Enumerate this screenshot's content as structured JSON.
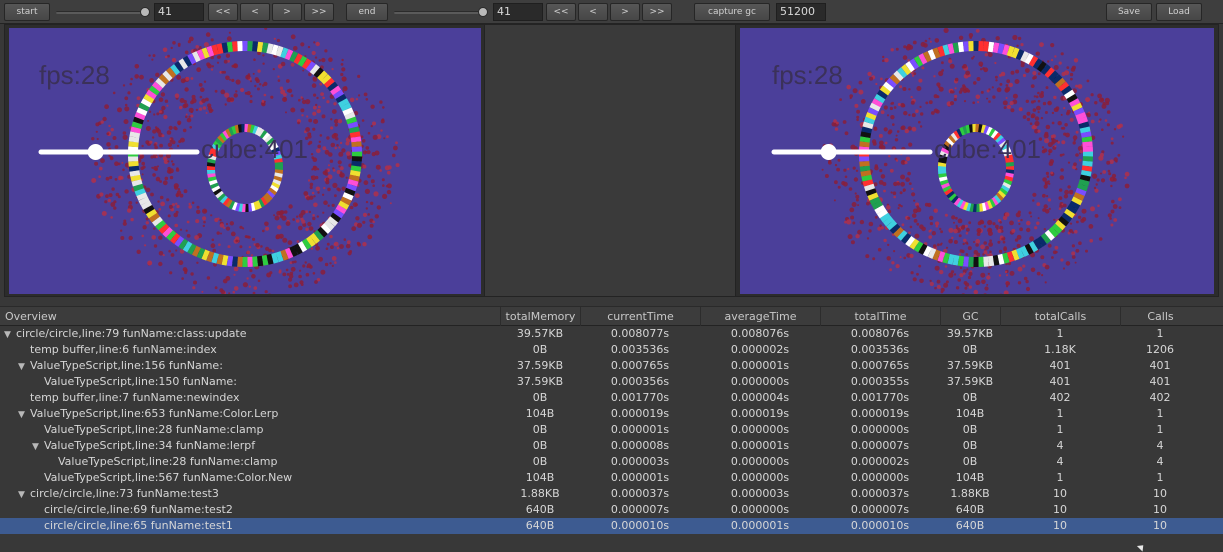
{
  "toolbar": {
    "start_label": "start",
    "start_value": "41",
    "end_label": "end",
    "end_value": "41",
    "nav": [
      "<<",
      "<",
      ">",
      ">>"
    ],
    "capture_gc_label": "capture gc",
    "capture_gc_value": "51200",
    "save_label": "Save",
    "load_label": "Load"
  },
  "preview": {
    "fps_text": "fps:28",
    "cube_text": "cube:401",
    "background": "#4b3f9a",
    "slider_level": 0.35
  },
  "table": {
    "columns": [
      "Overview",
      "totalMemory",
      "currentTime",
      "averageTime",
      "totalTime",
      "GC",
      "totalCalls",
      "Calls"
    ],
    "rows": [
      {
        "expander": "▼",
        "name": "circle/circle,line:79 funName:class:update",
        "totalMemory": "39.57KB",
        "currentTime": "0.008077s",
        "averageTime": "0.008076s",
        "totalTime": "0.008076s",
        "gc": "39.57KB",
        "totalCalls": "1",
        "calls": "1"
      },
      {
        "expander": "",
        "name": "temp buffer,line:6 funName:index",
        "totalMemory": "0B",
        "currentTime": "0.003536s",
        "averageTime": "0.000002s",
        "totalTime": "0.003536s",
        "gc": "0B",
        "totalCalls": "1.18K",
        "calls": "1206"
      },
      {
        "expander": "▼",
        "name": "ValueTypeScript,line:156 funName:",
        "totalMemory": "37.59KB",
        "currentTime": "0.000765s",
        "averageTime": "0.000001s",
        "totalTime": "0.000765s",
        "gc": "37.59KB",
        "totalCalls": "401",
        "calls": "401"
      },
      {
        "expander": "",
        "name": "ValueTypeScript,line:150 funName:",
        "totalMemory": "37.59KB",
        "currentTime": "0.000356s",
        "averageTime": "0.000000s",
        "totalTime": "0.000355s",
        "gc": "37.59KB",
        "totalCalls": "401",
        "calls": "401"
      },
      {
        "expander": "",
        "name": "temp buffer,line:7 funName:newindex",
        "totalMemory": "0B",
        "currentTime": "0.001770s",
        "averageTime": "0.000004s",
        "totalTime": "0.001770s",
        "gc": "0B",
        "totalCalls": "402",
        "calls": "402"
      },
      {
        "expander": "▼",
        "name": "ValueTypeScript,line:653 funName:Color.Lerp",
        "totalMemory": "104B",
        "currentTime": "0.000019s",
        "averageTime": "0.000019s",
        "totalTime": "0.000019s",
        "gc": "104B",
        "totalCalls": "1",
        "calls": "1"
      },
      {
        "expander": "",
        "name": "ValueTypeScript,line:28 funName:clamp",
        "totalMemory": "0B",
        "currentTime": "0.000001s",
        "averageTime": "0.000000s",
        "totalTime": "0.000000s",
        "gc": "0B",
        "totalCalls": "1",
        "calls": "1"
      },
      {
        "expander": "▼",
        "name": "ValueTypeScript,line:34 funName:lerpf",
        "totalMemory": "0B",
        "currentTime": "0.000008s",
        "averageTime": "0.000001s",
        "totalTime": "0.000007s",
        "gc": "0B",
        "totalCalls": "4",
        "calls": "4"
      },
      {
        "expander": "",
        "name": "ValueTypeScript,line:28 funName:clamp",
        "totalMemory": "0B",
        "currentTime": "0.000003s",
        "averageTime": "0.000000s",
        "totalTime": "0.000002s",
        "gc": "0B",
        "totalCalls": "4",
        "calls": "4"
      },
      {
        "expander": "",
        "name": "ValueTypeScript,line:567 funName:Color.New",
        "totalMemory": "104B",
        "currentTime": "0.000001s",
        "averageTime": "0.000000s",
        "totalTime": "0.000000s",
        "gc": "104B",
        "totalCalls": "1",
        "calls": "1"
      },
      {
        "expander": "▼",
        "name": "circle/circle,line:73 funName:test3",
        "totalMemory": "1.88KB",
        "currentTime": "0.000037s",
        "averageTime": "0.000003s",
        "totalTime": "0.000037s",
        "gc": "1.88KB",
        "totalCalls": "10",
        "calls": "10"
      },
      {
        "expander": "",
        "name": "circle/circle,line:69 funName:test2",
        "totalMemory": "640B",
        "currentTime": "0.000007s",
        "averageTime": "0.000000s",
        "totalTime": "0.000007s",
        "gc": "640B",
        "totalCalls": "10",
        "calls": "10"
      },
      {
        "expander": "",
        "name": "circle/circle,line:65 funName:test1",
        "totalMemory": "640B",
        "currentTime": "0.000010s",
        "averageTime": "0.000001s",
        "totalTime": "0.000010s",
        "gc": "640B",
        "totalCalls": "10",
        "calls": "10",
        "selected": true
      }
    ]
  },
  "colors": {
    "selection": "#3d5b91",
    "panel": "#383838"
  }
}
